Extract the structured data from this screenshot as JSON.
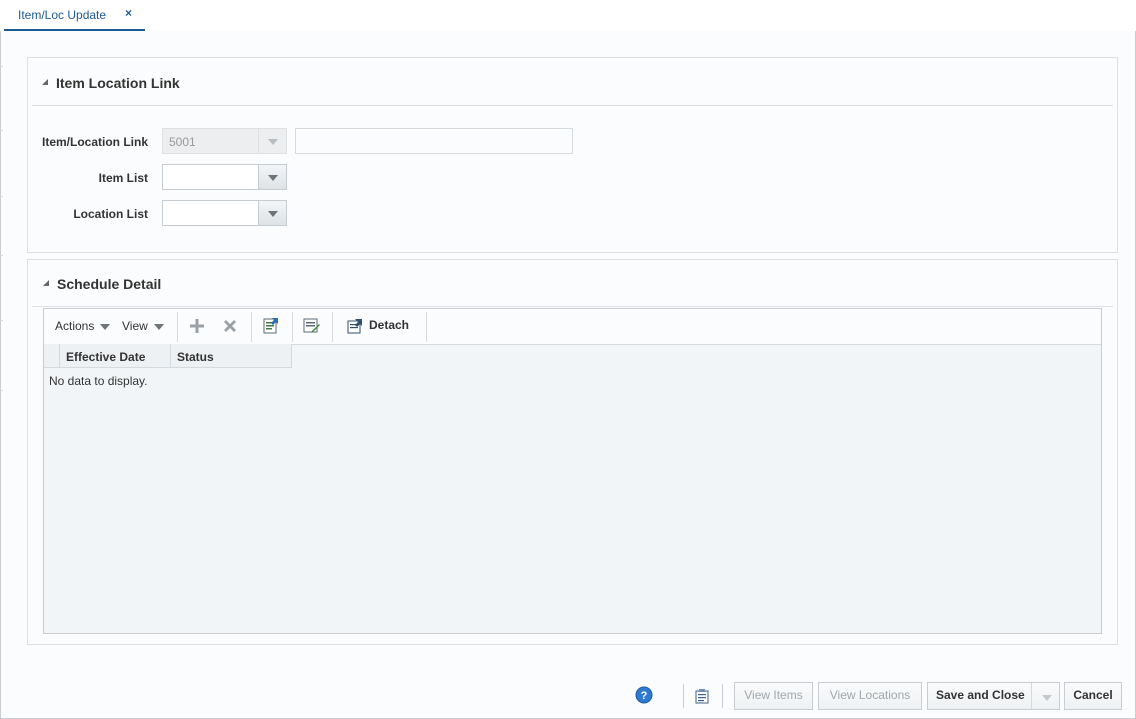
{
  "tab": {
    "label": "Item/Loc Update",
    "close_glyph": "×"
  },
  "item_location_section": {
    "title": "Item Location Link",
    "fields": {
      "link_label": "Item/Location Link",
      "link_value": "5001",
      "link_description": "",
      "item_list_label": "Item List",
      "item_list_value": "",
      "location_list_label": "Location List",
      "location_list_value": ""
    }
  },
  "schedule_section": {
    "title": "Schedule Detail",
    "toolbar": {
      "actions_label": "Actions",
      "view_label": "View",
      "detach_label": "Detach",
      "icons": [
        "add-icon",
        "delete-icon",
        "export-icon",
        "edit-icon",
        "detach-icon"
      ]
    },
    "columns": [
      "Effective Date",
      "Status"
    ],
    "empty_text": "No data to display."
  },
  "footer": {
    "help_icon": "help-icon",
    "notes_icon": "notes-icon",
    "view_items_label": "View Items",
    "view_locations_label": "View Locations",
    "save_close_label": "Save and Close",
    "cancel_label": "Cancel"
  },
  "colors": {
    "accent": "#1e5a94",
    "help": "#2f7ad1"
  }
}
